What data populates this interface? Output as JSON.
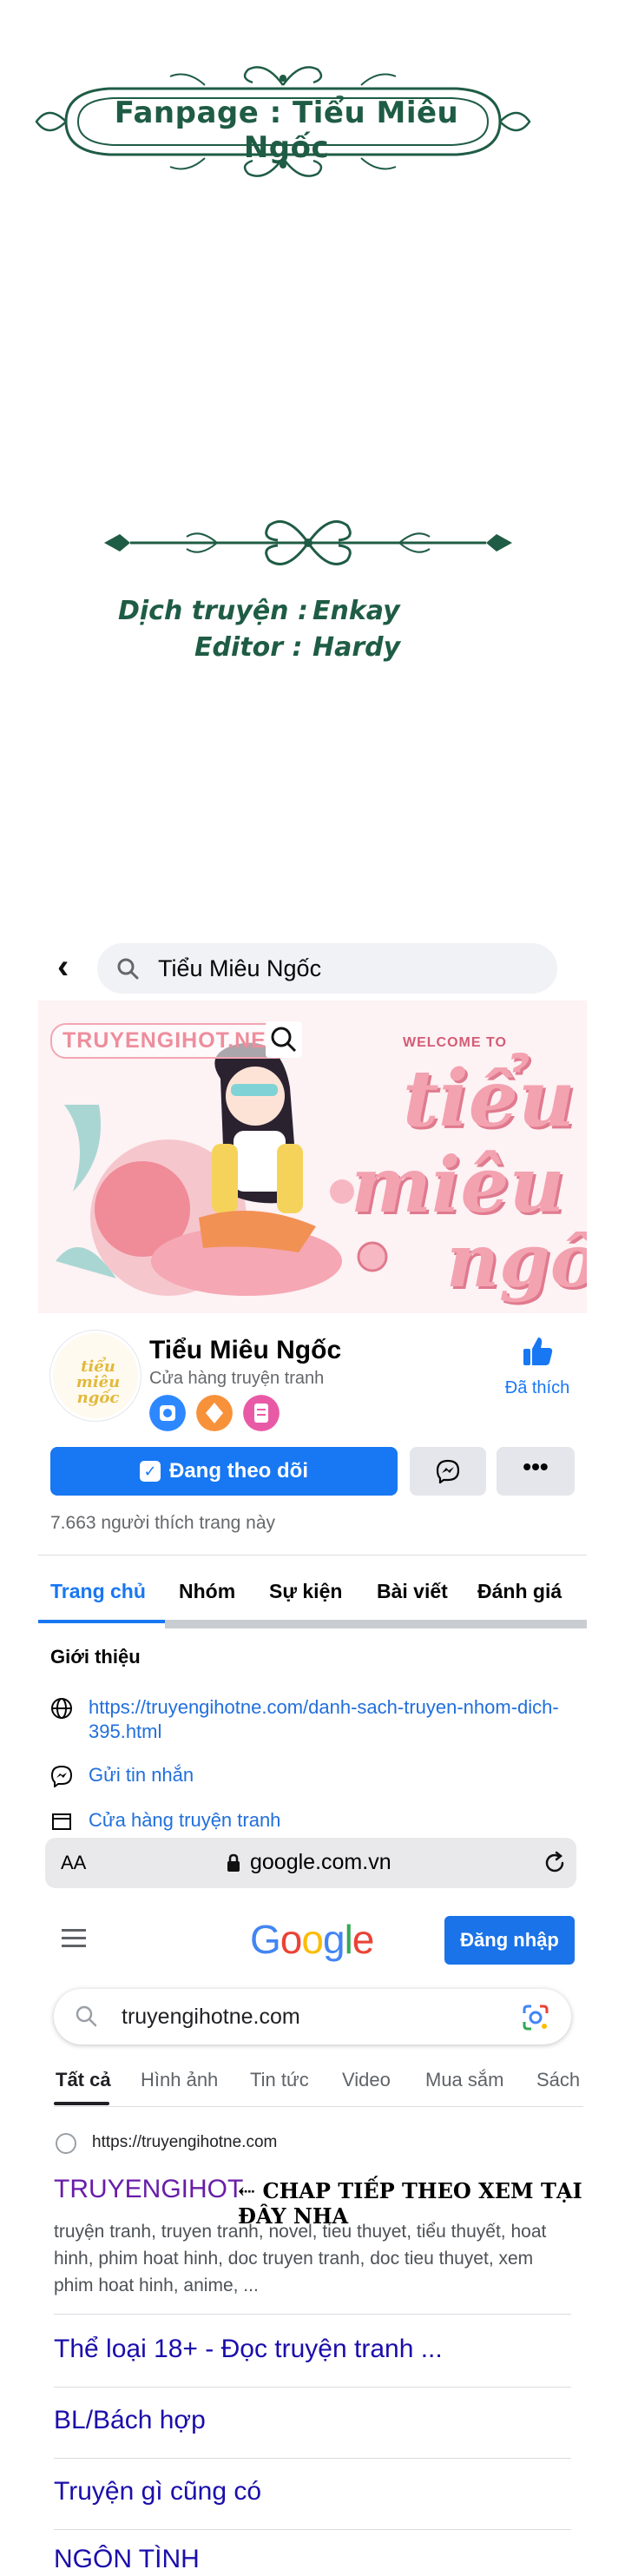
{
  "credits": {
    "fanpage": "Fanpage : Tiểu Miêu Ngốc",
    "translate_label": "Dịch truyện :",
    "translate_value": "Enkay",
    "editor_label": "Editor :",
    "editor_value": "Hardy"
  },
  "facebook": {
    "search_text": "Tiểu Miêu Ngốc",
    "cover": {
      "watermark": "TRUYENGIHOT.NET",
      "welcome": "WELCOME TO",
      "line1": "tiểu",
      "line2": "miêu",
      "line3": "ngốc"
    },
    "avatar_text": "tiểu miêu ngốc",
    "page_name": "Tiểu Miêu Ngốc",
    "page_category": "Cửa hàng truyện tranh",
    "like_label": "Đã thích",
    "follow_label": "Đang theo dõi",
    "more_label": "•••",
    "likes_count": "7.663 người thích trang này",
    "tabs": [
      "Trang chủ",
      "Nhóm",
      "Sự kiện",
      "Bài viết",
      "Đánh giá"
    ],
    "intro_heading": "Giới thiệu",
    "intro_link": "https://truyengihotne.com/danh-sach-truyen-nhom-dich-395.html",
    "intro_message": "Gửi tin nhắn",
    "intro_shop": "Cửa hàng truyện tranh",
    "colors": {
      "brand": "#1877f2",
      "credits_green": "#1f5c45"
    }
  },
  "safari": {
    "aa_label": "AA",
    "url": "google.com.vn"
  },
  "google": {
    "logo": "Google",
    "login_label": "Đăng nhập",
    "query": "truyengihotne.com",
    "tabs": [
      "Tất cả",
      "Hình ảnh",
      "Tin tức",
      "Video",
      "Mua sắm",
      "Sách"
    ],
    "result": {
      "url": "https://truyengihotne.com",
      "title": "TRUYENGIHOT",
      "annotation": "⇠ CHAP TIẾP THEO XEM TẠI ĐÂY NHA",
      "snippet": "truyện tranh, truyen tranh, novel, tieu thuyet, tiểu thuyết, hoat hinh, phim hoat hinh, doc truyen tranh, doc tieu thuyet, xem phim hoat hinh, anime, ..."
    },
    "sitelinks": [
      "Thể loại 18+ - Đọc truyện tranh ...",
      "BL/Bách hợp",
      "Truyện gì cũng có",
      "NGÔN TÌNH"
    ]
  }
}
